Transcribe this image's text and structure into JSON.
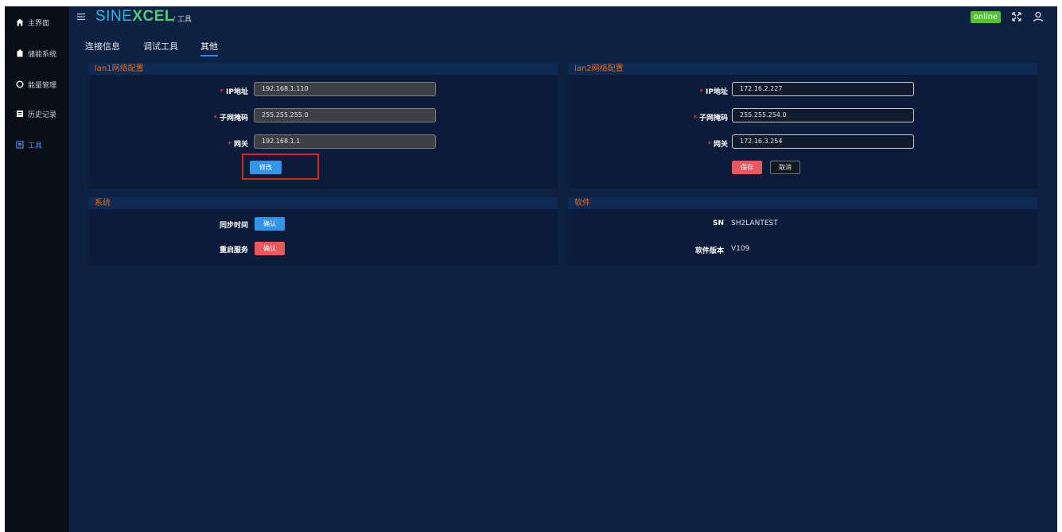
{
  "sidebar": {
    "items": [
      {
        "label": "主界面",
        "icon": "home-icon"
      },
      {
        "label": "储能系统",
        "icon": "battery-icon"
      },
      {
        "label": "能量管理",
        "icon": "power-icon"
      },
      {
        "label": "历史记录",
        "icon": "record-icon"
      },
      {
        "label": "工具",
        "icon": "toolbox-icon"
      }
    ]
  },
  "header": {
    "logo_a": "SINE",
    "logo_b": "XCEL",
    "breadcrumb_sep": "/",
    "breadcrumb": "工具",
    "status": "online"
  },
  "tabs": [
    {
      "label": "连接信息"
    },
    {
      "label": "调试工具"
    },
    {
      "label": "其他"
    }
  ],
  "lan1": {
    "title": "lan1网络配置",
    "ip_label": "IP地址",
    "ip_value": "192.168.1.110",
    "mask_label": "子网掩码",
    "mask_value": "255.255.255.0",
    "gw_label": "网关",
    "gw_value": "192.168.1.1",
    "modify": "修改"
  },
  "lan2": {
    "title": "lan2网络配置",
    "ip_label": "IP地址",
    "ip_value": "172.16.2.227",
    "mask_label": "子网掩码",
    "mask_value": "255.255.254.0",
    "gw_label": "网关",
    "gw_value": "172.16.3.254",
    "save": "保存",
    "cancel": "取消"
  },
  "system": {
    "title": "系统",
    "sync_label": "同步时间",
    "sync_btn": "确认",
    "restart_label": "重启服务",
    "restart_btn": "确认"
  },
  "software": {
    "title": "软件",
    "sn_label": "SN",
    "sn_value": "SH2LANTEST",
    "version_label": "软件版本",
    "version_value": "V109"
  },
  "colors": {
    "accent": "#3395e8",
    "danger": "#e8585f",
    "online": "#53c13a",
    "section_title": "#e46a1a"
  }
}
